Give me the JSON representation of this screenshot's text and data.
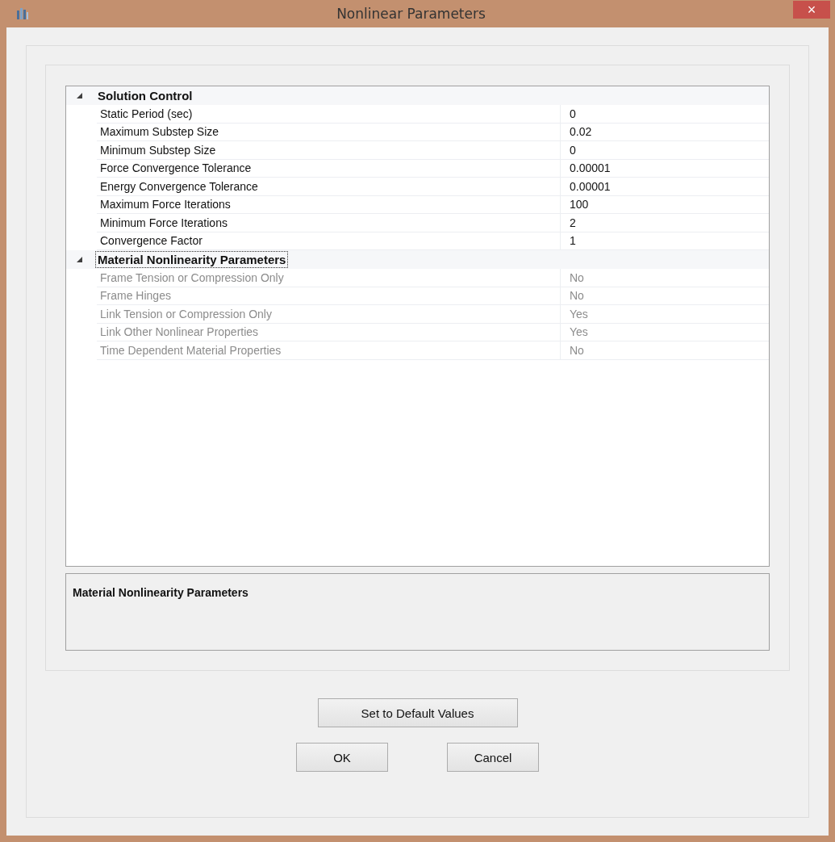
{
  "window": {
    "title": "Nonlinear Parameters",
    "close": "×"
  },
  "property_grid": {
    "categories": [
      {
        "label": "Solution Control",
        "expanded": true,
        "selected": false,
        "properties": [
          {
            "name": "Static Period (sec)",
            "value": "0",
            "disabled": false
          },
          {
            "name": "Maximum Substep Size",
            "value": "0.02",
            "disabled": false
          },
          {
            "name": "Minimum Substep Size",
            "value": "0",
            "disabled": false
          },
          {
            "name": "Force Convergence Tolerance",
            "value": "0.00001",
            "disabled": false
          },
          {
            "name": "Energy Convergence Tolerance",
            "value": "0.00001",
            "disabled": false
          },
          {
            "name": "Maximum Force Iterations",
            "value": "100",
            "disabled": false
          },
          {
            "name": "Minimum Force Iterations",
            "value": "2",
            "disabled": false
          },
          {
            "name": "Convergence Factor",
            "value": "1",
            "disabled": false
          }
        ]
      },
      {
        "label": "Material Nonlinearity Parameters",
        "expanded": true,
        "selected": true,
        "properties": [
          {
            "name": "Frame Tension or Compression Only",
            "value": "No",
            "disabled": true
          },
          {
            "name": "Frame Hinges",
            "value": "No",
            "disabled": true
          },
          {
            "name": "Link Tension or Compression Only",
            "value": "Yes",
            "disabled": true
          },
          {
            "name": "Link Other Nonlinear Properties",
            "value": "Yes",
            "disabled": true
          },
          {
            "name": "Time Dependent Material Properties",
            "value": "No",
            "disabled": true
          }
        ]
      }
    ]
  },
  "description": {
    "title": "Material Nonlinearity Parameters"
  },
  "buttons": [
    {
      "label": "Set to Default Values",
      "kind": "wide"
    },
    {
      "label": "OK",
      "kind": "normal"
    },
    {
      "label": "Cancel",
      "kind": "normal"
    }
  ]
}
